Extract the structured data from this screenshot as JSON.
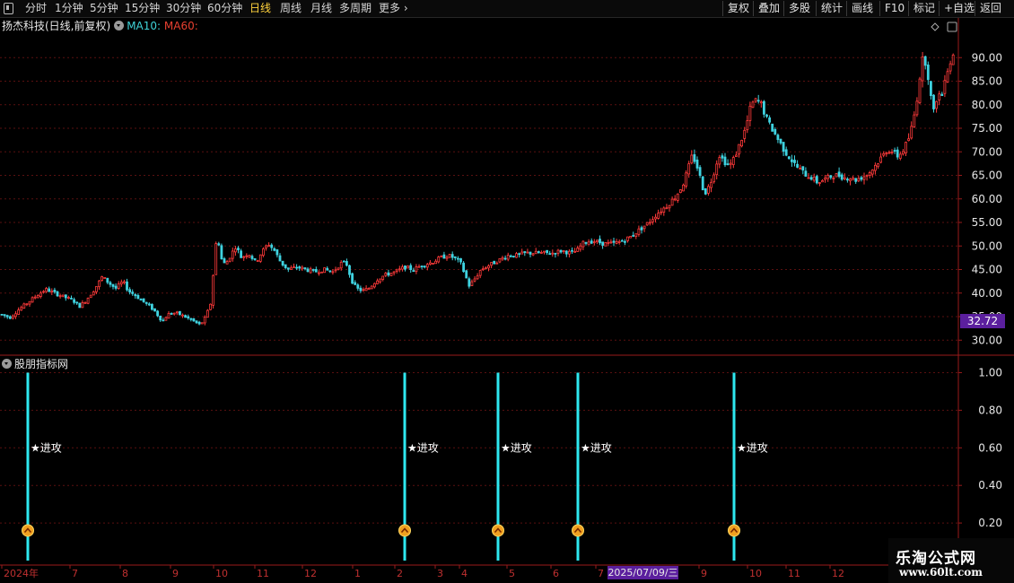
{
  "toolbar": {
    "periods": [
      "分时",
      "1分钟",
      "5分钟",
      "15分钟",
      "30分钟",
      "60分钟",
      "日线",
      "周线",
      "月线",
      "多周期",
      "更多"
    ],
    "active": "日线",
    "right_buttons": [
      "复权",
      "叠加",
      "多股",
      "统计",
      "画线",
      "F10",
      "标记",
      "+自选",
      "返回"
    ]
  },
  "title": {
    "stock": "扬杰科技(日线,前复权)",
    "ma10": "MA10:",
    "ma60": "MA60:"
  },
  "indicator": {
    "name": "股朋指标网"
  },
  "price_tag": "32.72",
  "date_tag": "2025/07/09/三",
  "watermark": {
    "line1": "乐淘公式网",
    "line2": "www.60lt.com"
  },
  "colors": {
    "up": "#ff3a3a",
    "down": "#3fd3e0",
    "signal": "#2ee8f0",
    "grid": "#5a1010",
    "axis": "#9a1a1a"
  },
  "chart_data": [
    {
      "type": "candlestick",
      "title": "扬杰科技(日线,前复权)",
      "ylim": [
        27,
        95
      ],
      "y_ticks": [
        "30.00",
        "35.00",
        "40.00",
        "45.00",
        "50.00",
        "55.00",
        "60.00",
        "65.00",
        "70.00",
        "75.00",
        "80.00",
        "85.00",
        "90.00"
      ],
      "y_tick_values": [
        30,
        35,
        40,
        45,
        50,
        55,
        60,
        65,
        70,
        75,
        80,
        85,
        90
      ],
      "close_series": [
        [
          0,
          35.5
        ],
        [
          10,
          34.8
        ],
        [
          20,
          36.5
        ],
        [
          30,
          38
        ],
        [
          40,
          39.5
        ],
        [
          50,
          40.8
        ],
        [
          60,
          40
        ],
        [
          70,
          39.2
        ],
        [
          80,
          38.5
        ],
        [
          88,
          37.2
        ],
        [
          95,
          38.5
        ],
        [
          105,
          41
        ],
        [
          113,
          43.5
        ],
        [
          120,
          42.2
        ],
        [
          128,
          41
        ],
        [
          136,
          42.5
        ],
        [
          142,
          40.5
        ],
        [
          150,
          39.5
        ],
        [
          160,
          38
        ],
        [
          170,
          36.5
        ],
        [
          180,
          34
        ],
        [
          186,
          35.5
        ],
        [
          195,
          35.8
        ],
        [
          205,
          35
        ],
        [
          215,
          34
        ],
        [
          222,
          33.2
        ],
        [
          228,
          34.8
        ],
        [
          234,
          38
        ],
        [
          238,
          47
        ],
        [
          241,
          53
        ],
        [
          245,
          47.5
        ],
        [
          250,
          46
        ],
        [
          256,
          48
        ],
        [
          262,
          50
        ],
        [
          268,
          47.5
        ],
        [
          276,
          48.5
        ],
        [
          284,
          46.5
        ],
        [
          290,
          48.5
        ],
        [
          298,
          50.5
        ],
        [
          305,
          49
        ],
        [
          312,
          46.5
        ],
        [
          320,
          45
        ],
        [
          330,
          45.5
        ],
        [
          340,
          45
        ],
        [
          350,
          44.5
        ],
        [
          360,
          45
        ],
        [
          370,
          44.5
        ],
        [
          380,
          46.5
        ],
        [
          386,
          46
        ],
        [
          390,
          43
        ],
        [
          396,
          41
        ],
        [
          403,
          40.5
        ],
        [
          410,
          41
        ],
        [
          420,
          43
        ],
        [
          430,
          44
        ],
        [
          440,
          44.5
        ],
        [
          450,
          45.5
        ],
        [
          460,
          45
        ],
        [
          470,
          46
        ],
        [
          480,
          46.5
        ],
        [
          490,
          47.5
        ],
        [
          498,
          48
        ],
        [
          505,
          47.5
        ],
        [
          512,
          46.5
        ],
        [
          518,
          43.5
        ],
        [
          522,
          41.5
        ],
        [
          528,
          43
        ],
        [
          535,
          45
        ],
        [
          545,
          46
        ],
        [
          555,
          47
        ],
        [
          565,
          48
        ],
        [
          575,
          48
        ],
        [
          585,
          48.5
        ],
        [
          595,
          48.5
        ],
        [
          605,
          48.5
        ],
        [
          615,
          48.5
        ],
        [
          625,
          49
        ],
        [
          635,
          48.5
        ],
        [
          642,
          49
        ],
        [
          648,
          50.5
        ],
        [
          655,
          51
        ],
        [
          662,
          51
        ],
        [
          672,
          50.5
        ],
        [
          682,
          50.5
        ],
        [
          692,
          51
        ],
        [
          702,
          52
        ],
        [
          712,
          53.5
        ],
        [
          722,
          55
        ],
        [
          732,
          57
        ],
        [
          742,
          58.5
        ],
        [
          752,
          60.5
        ],
        [
          760,
          63
        ],
        [
          766,
          66.5
        ],
        [
          770,
          69
        ],
        [
          774,
          68
        ],
        [
          778,
          65.5
        ],
        [
          784,
          61
        ],
        [
          790,
          63
        ],
        [
          796,
          66.5
        ],
        [
          800,
          69.5
        ],
        [
          806,
          68
        ],
        [
          812,
          67
        ],
        [
          818,
          69
        ],
        [
          824,
          72
        ],
        [
          830,
          75
        ],
        [
          836,
          80
        ],
        [
          842,
          81
        ],
        [
          848,
          80
        ],
        [
          852,
          77.5
        ],
        [
          856,
          76
        ],
        [
          862,
          74
        ],
        [
          868,
          72
        ],
        [
          874,
          70
        ],
        [
          880,
          68.5
        ],
        [
          886,
          67
        ],
        [
          892,
          66
        ],
        [
          898,
          65
        ],
        [
          904,
          64.5
        ],
        [
          910,
          63.5
        ],
        [
          916,
          64
        ],
        [
          922,
          64.5
        ],
        [
          928,
          65
        ],
        [
          934,
          65
        ],
        [
          940,
          64.5
        ],
        [
          946,
          64.5
        ],
        [
          952,
          64
        ],
        [
          958,
          64.5
        ],
        [
          964,
          65
        ],
        [
          970,
          66
        ],
        [
          976,
          67.5
        ],
        [
          982,
          69
        ],
        [
          988,
          70.5
        ],
        [
          994,
          70
        ],
        [
          1000,
          69
        ],
        [
          1006,
          70.5
        ],
        [
          1012,
          73
        ],
        [
          1016,
          76
        ],
        [
          1020,
          80
        ],
        [
          1024,
          86
        ],
        [
          1028,
          90.5
        ],
        [
          1032,
          88
        ],
        [
          1036,
          82
        ],
        [
          1040,
          78
        ],
        [
          1044,
          83
        ],
        [
          1048,
          81
        ],
        [
          1052,
          86
        ],
        [
          1056,
          88
        ],
        [
          1062,
          91
        ]
      ]
    },
    {
      "type": "bar",
      "title": "股朋指标网",
      "ylim": [
        0,
        1.05
      ],
      "y_ticks": [
        "0.20",
        "0.40",
        "0.60",
        "0.80",
        "1.00"
      ],
      "y_tick_values": [
        0.2,
        0.4,
        0.6,
        0.8,
        1.0
      ],
      "series": [
        {
          "name": "",
          "x": [
            31,
            451,
            555,
            644,
            818
          ],
          "values": [
            1,
            1,
            1,
            1,
            1
          ]
        }
      ],
      "annotation": "★进攻"
    }
  ],
  "x_axis_labels": [
    "2024年",
    "7",
    "8",
    "9",
    "10",
    "11",
    "12",
    "1",
    "2",
    "3",
    "4",
    "5",
    "6",
    "7",
    "9",
    "10",
    "11",
    "12"
  ],
  "x_axis_positions": [
    2,
    78,
    134,
    190,
    238,
    284,
    337,
    393,
    440,
    485,
    512,
    565,
    614,
    664,
    779,
    833,
    876,
    925
  ]
}
